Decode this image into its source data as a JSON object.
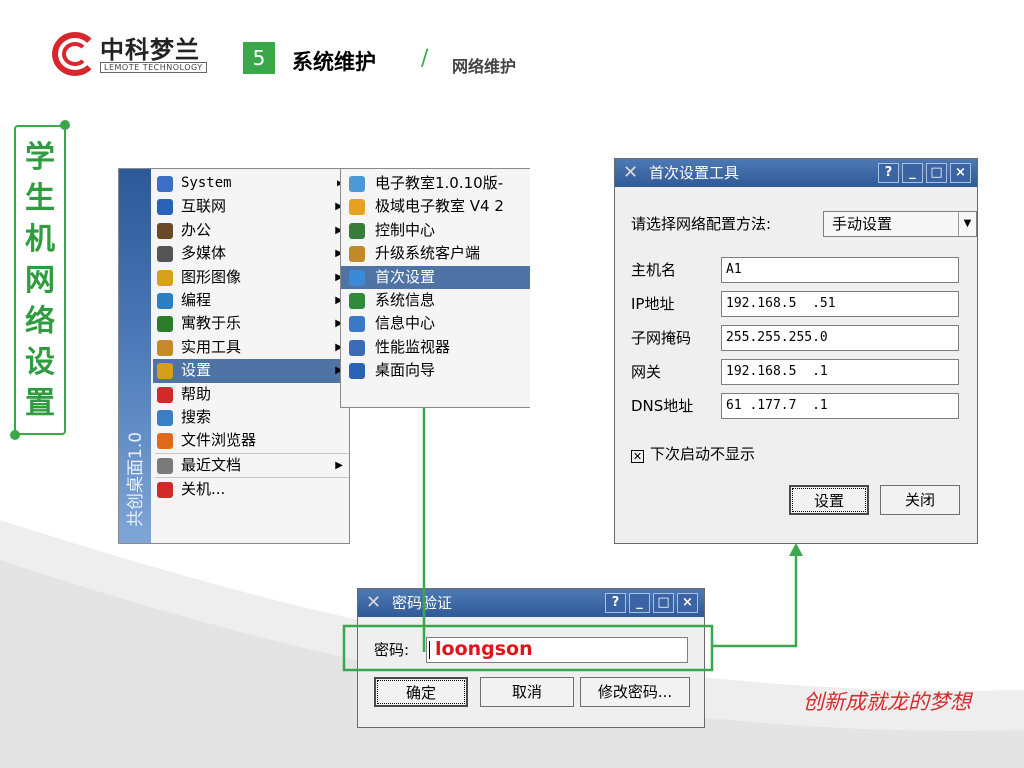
{
  "header": {
    "logo_cn": "中科梦兰",
    "logo_en": "LEMOTE TECHNOLOGY",
    "section_number": "5",
    "section_title": "系统维护",
    "separator": "/",
    "section_subtitle": "网络维护"
  },
  "side_banner": [
    "学",
    "生",
    "机",
    "网",
    "络",
    "设",
    "置"
  ],
  "start_menu": {
    "side_label": "共创桌面1.0",
    "items": [
      {
        "label": "System",
        "icon": "folder-icon",
        "color": "#3a6fc4",
        "submenu": true
      },
      {
        "label": "互联网",
        "icon": "globe-icon",
        "color": "#2a62b8",
        "submenu": true
      },
      {
        "label": "办公",
        "icon": "office-icon",
        "color": "#6b4a2a",
        "submenu": true
      },
      {
        "label": "多媒体",
        "icon": "media-icon",
        "color": "#555555",
        "submenu": true
      },
      {
        "label": "图形图像",
        "icon": "graphics-icon",
        "color": "#d9a020",
        "submenu": true
      },
      {
        "label": "编程",
        "icon": "code-icon",
        "color": "#2d7fc0",
        "submenu": true
      },
      {
        "label": "寓教于乐",
        "icon": "game-icon",
        "color": "#2c7a2c",
        "submenu": true
      },
      {
        "label": "实用工具",
        "icon": "tools-icon",
        "color": "#c68a2a",
        "submenu": true
      },
      {
        "label": "设置",
        "icon": "wrench-icon",
        "color": "#d4a017",
        "submenu": true,
        "active": true
      },
      {
        "label": "帮助",
        "icon": "lifebuoy-icon",
        "color": "#d02a2a",
        "submenu": false
      },
      {
        "label": "搜索",
        "icon": "magnifier-icon",
        "color": "#3a7fc4",
        "submenu": false
      },
      {
        "label": "文件浏览器",
        "icon": "home-icon",
        "color": "#e06a1a",
        "submenu": false
      },
      {
        "label": "最近文档",
        "icon": "document-icon",
        "color": "#7a7a7a",
        "submenu": true
      },
      {
        "label": "关机...",
        "icon": "power-icon",
        "color": "#d02a2a",
        "submenu": false
      }
    ]
  },
  "settings_submenu": {
    "items": [
      {
        "label": "电子教室1.0.10版-",
        "icon": "classroom-icon",
        "color": "#4a9ad8"
      },
      {
        "label": "极域电子教室 V4 2",
        "icon": "classroom-orange-icon",
        "color": "#e8a020"
      },
      {
        "label": "控制中心",
        "icon": "control-center-icon",
        "color": "#3a7a3a"
      },
      {
        "label": "升级系统客户端",
        "icon": "upgrade-icon",
        "color": "#c08a2a"
      },
      {
        "label": "首次设置",
        "icon": "setup-icon",
        "color": "#3a8ad8",
        "active": true
      },
      {
        "label": "系统信息",
        "icon": "system-info-icon",
        "color": "#2f8a3a"
      },
      {
        "label": "信息中心",
        "icon": "info-center-icon",
        "color": "#3a7ac4"
      },
      {
        "label": "性能监视器",
        "icon": "monitor-icon",
        "color": "#3a6ab8"
      },
      {
        "label": "桌面向导",
        "icon": "desktop-wizard-icon",
        "color": "#2a62b8"
      }
    ]
  },
  "setup_dialog": {
    "title": "首次设置工具",
    "title_buttons": [
      "?",
      "_",
      "□",
      "×"
    ],
    "method_label": "请选择网络配置方法:",
    "method_value": "手动设置",
    "fields": [
      {
        "label": "主机名",
        "value": "A1"
      },
      {
        "label": "IP地址",
        "value": "192.168.5  .51"
      },
      {
        "label": "子网掩码",
        "value": "255.255.255.0"
      },
      {
        "label": "网关",
        "value": "192.168.5  .1"
      },
      {
        "label": "DNS地址",
        "value": "61 .177.7  .1"
      }
    ],
    "checkbox_label": "下次启动不显示",
    "checkbox_checked": true,
    "ok_button": "设置",
    "close_button": "关闭"
  },
  "password_dialog": {
    "title": "密码验证",
    "title_buttons": [
      "?",
      "_",
      "□",
      "×"
    ],
    "label": "密码:",
    "value": "loongson",
    "ok_button": "确定",
    "cancel_button": "取消",
    "change_button": "修改密码..."
  },
  "slogan": "创新成就龙的梦想",
  "colors": {
    "accent_green": "#3aa84a",
    "brand_red": "#d7262e",
    "title_bar_blue": "#2f5a98",
    "menu_highlight": "#5073a6",
    "password_text": "#e1141b"
  }
}
